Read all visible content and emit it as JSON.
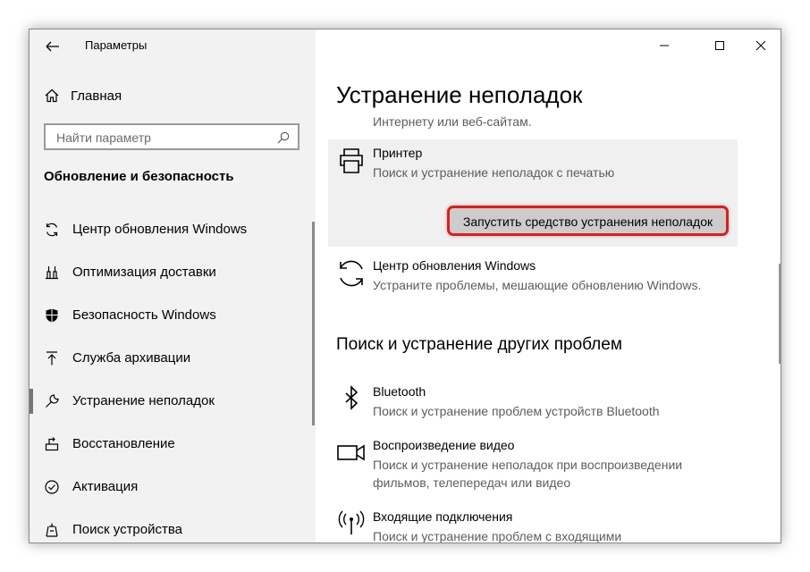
{
  "window": {
    "title": "Параметры",
    "controls": {
      "minimize": "minimize-icon",
      "maximize": "maximize-icon",
      "close": "close-icon"
    }
  },
  "sidebar": {
    "home_label": "Главная",
    "search_placeholder": "Найти параметр",
    "section_title": "Обновление и безопасность",
    "items": [
      {
        "label": "Центр обновления Windows",
        "icon": "sync-icon"
      },
      {
        "label": "Оптимизация доставки",
        "icon": "delivery-icon"
      },
      {
        "label": "Безопасность Windows",
        "icon": "shield-icon"
      },
      {
        "label": "Служба архивации",
        "icon": "backup-icon"
      },
      {
        "label": "Устранение неполадок",
        "icon": "wrench-icon",
        "active": true
      },
      {
        "label": "Восстановление",
        "icon": "recovery-icon"
      },
      {
        "label": "Активация",
        "icon": "activation-icon"
      },
      {
        "label": "Поиск устройства",
        "icon": "find-device-icon"
      }
    ]
  },
  "main": {
    "title": "Устранение неполадок",
    "cut_text": "Интернету или веб-сайтам.",
    "printer": {
      "title": "Принтер",
      "desc": "Поиск и устранение неполадок с печатью",
      "button": "Запустить средство устранения неполадок"
    },
    "windows_update": {
      "title": "Центр обновления Windows",
      "desc": "Устраните проблемы, мешающие обновлению Windows."
    },
    "other_title": "Поиск и устранение других проблем",
    "bluetooth": {
      "title": "Bluetooth",
      "desc": "Поиск и устранение проблем устройств Bluetooth"
    },
    "video": {
      "title": "Воспроизведение видео",
      "desc1": "Поиск и устранение неполадок при воспроизведении",
      "desc2": "фильмов, телепередач или видео"
    },
    "incoming": {
      "title": "Входящие подключения",
      "desc": "Поиск и устранение проблем с входящими"
    }
  },
  "colors": {
    "highlight_border": "#e21a1a",
    "sidebar_bg": "#f2f2f2",
    "card_bg": "#f0f0f0",
    "button_bg": "#cccccc"
  }
}
